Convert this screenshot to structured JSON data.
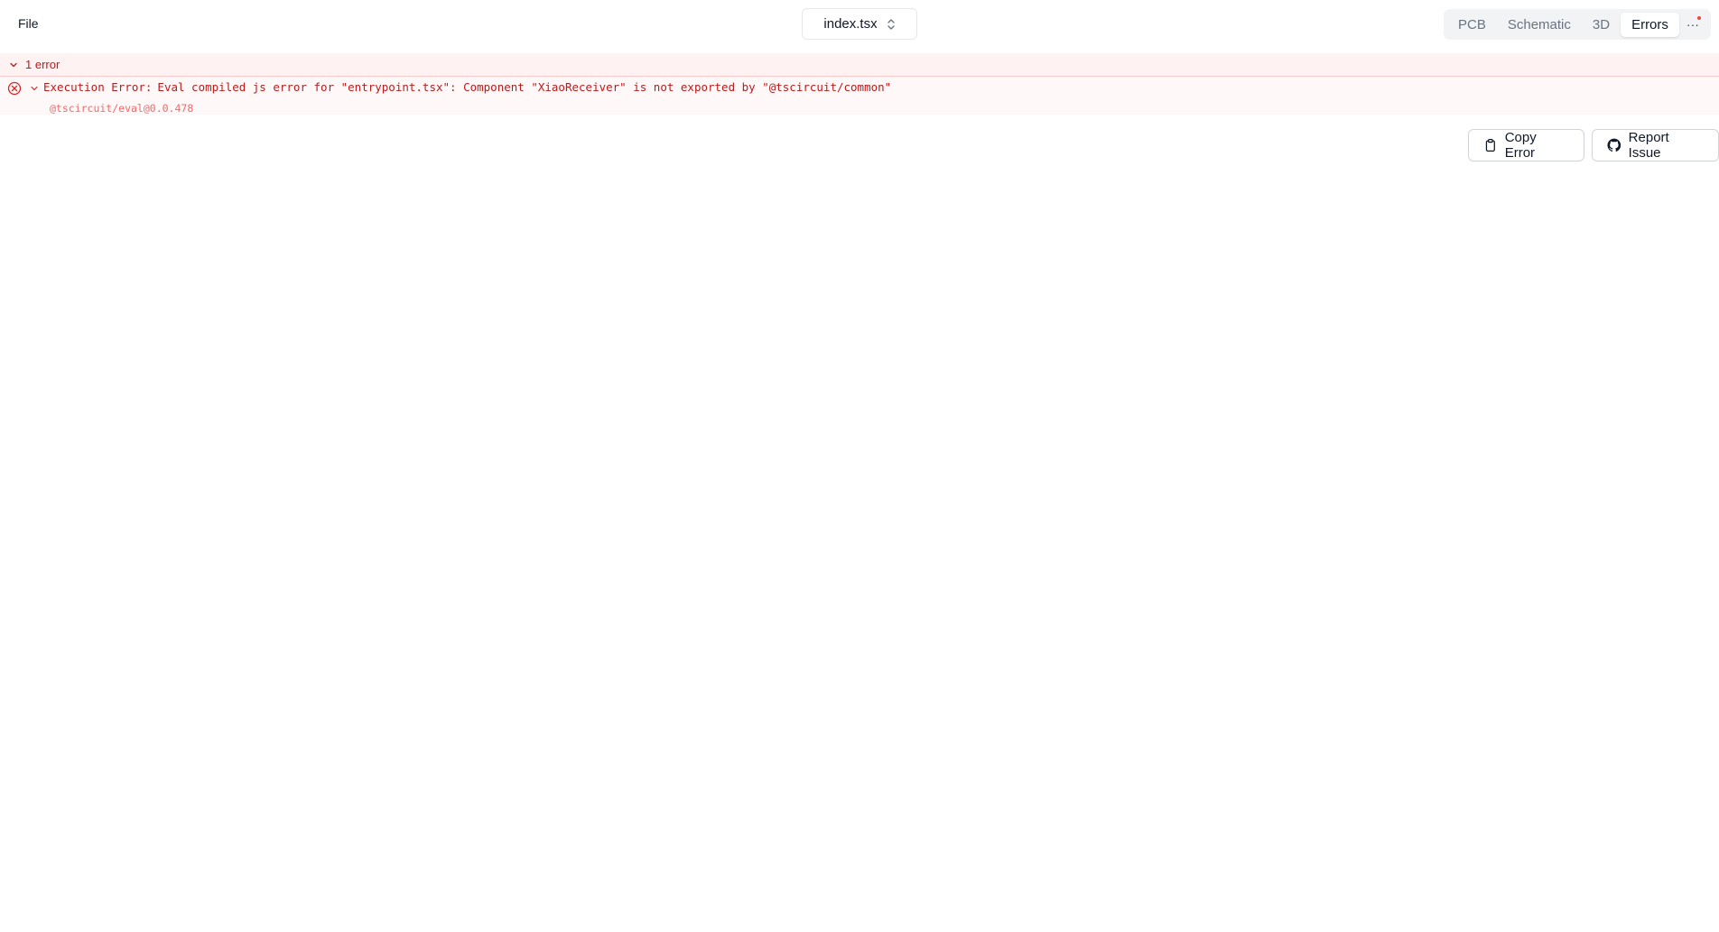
{
  "menu": {
    "file_label": "File"
  },
  "file_selector": {
    "value": "index.tsx"
  },
  "view_tabs": [
    {
      "label": "PCB",
      "active": false
    },
    {
      "label": "Schematic",
      "active": false
    },
    {
      "label": "3D",
      "active": false
    },
    {
      "label": "Errors",
      "active": true
    }
  ],
  "more_label": "···",
  "errors": {
    "count_label": "1 error",
    "items": [
      {
        "type": "Execution Error:",
        "message": "Eval compiled js error for \"entrypoint.tsx\": Component \"XiaoReceiver\" is not exported by \"@tscircuit/common\"",
        "source": "@tscircuit/eval@0.0.478"
      }
    ]
  },
  "actions": {
    "copy_label": "Copy Error",
    "report_label": "Report Issue"
  },
  "colors": {
    "error_text": "#b91c1c",
    "error_bg": "#fef2f2",
    "notification_dot": "#ef4444"
  },
  "icons": [
    "chevrons-up-down-icon",
    "chevron-down-icon",
    "error-circle-icon",
    "clipboard-icon",
    "github-icon"
  ]
}
